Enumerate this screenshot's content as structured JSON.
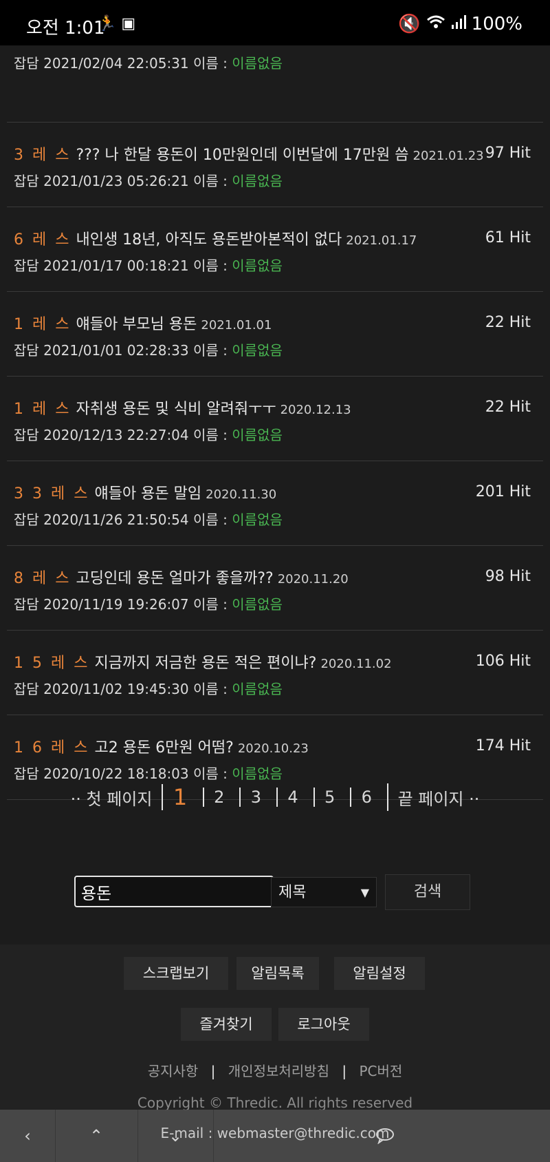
{
  "status_bar": {
    "time": "오전 1:01",
    "battery": "100%",
    "icons_left": [
      "person-icon",
      "document-icon"
    ],
    "icons_right": [
      "mute-icon",
      "wifi-icon",
      "signal-icon"
    ]
  },
  "partial_row": {
    "meta_category": "잡담",
    "meta_datetime": "2021/02/04 22:05:31",
    "meta_name_label": "이름 :",
    "meta_name": "이름없음"
  },
  "threads": [
    {
      "res": "3 레 스",
      "title": "??? 나 한달 용돈이 10만원인데 이번달에 17만원 씀",
      "date": "2021.01.23",
      "hits": "97 Hit",
      "category": "잡담",
      "datetime": "2021/01/23 05:26:21",
      "name_label": "이름 :",
      "name": "이름없음"
    },
    {
      "res": "6 레 스",
      "title": "내인생 18년, 아직도 용돈받아본적이 없다",
      "date": "2021.01.17",
      "hits": "61 Hit",
      "category": "잡담",
      "datetime": "2021/01/17 00:18:21",
      "name_label": "이름 :",
      "name": "이름없음"
    },
    {
      "res": "1 레 스",
      "title": "얘들아 부모님 용돈",
      "date": "2021.01.01",
      "hits": "22 Hit",
      "category": "잡담",
      "datetime": "2021/01/01 02:28:33",
      "name_label": "이름 :",
      "name": "이름없음"
    },
    {
      "res": "1 레 스",
      "title": "자취생 용돈 및 식비 알려줘ㅜㅜ",
      "date": "2020.12.13",
      "hits": "22 Hit",
      "category": "잡담",
      "datetime": "2020/12/13 22:27:04",
      "name_label": "이름 :",
      "name": "이름없음"
    },
    {
      "res": "3 3 레 스",
      "title": "얘들아 용돈 말임",
      "date": "2020.11.30",
      "hits": "201 Hit",
      "category": "잡담",
      "datetime": "2020/11/26 21:50:54",
      "name_label": "이름 :",
      "name": "이름없음"
    },
    {
      "res": "8 레 스",
      "title": "고딩인데 용돈 얼마가 좋을까??",
      "date": "2020.11.20",
      "hits": "98 Hit",
      "category": "잡담",
      "datetime": "2020/11/19 19:26:07",
      "name_label": "이름 :",
      "name": "이름없음"
    },
    {
      "res": "1 5 레 스",
      "title": "지금까지 저금한 용돈 적은 편이냐?",
      "date": "2020.11.02",
      "hits": "106 Hit",
      "category": "잡담",
      "datetime": "2020/11/02 19:45:30",
      "name_label": "이름 :",
      "name": "이름없음"
    },
    {
      "res": "1 6 레 스",
      "title": "고2 용돈 6만원 어떰?",
      "date": "2020.10.23",
      "hits": "174 Hit",
      "category": "잡담",
      "datetime": "2020/10/22 18:18:03",
      "name_label": "이름 :",
      "name": "이름없음"
    }
  ],
  "pagination": {
    "first_label": "·· 첫 페이지",
    "current": "1",
    "pages": [
      "2",
      "3",
      "4",
      "5",
      "6"
    ],
    "last_label": "끝 페이지 ··"
  },
  "search": {
    "value": "용돈",
    "select_value": "제목",
    "button_label": "검색"
  },
  "footer": {
    "buttons_row1": [
      "스크랩보기",
      "알림목록",
      "알림설정"
    ],
    "buttons_row2": [
      "즐겨찾기",
      "로그아웃"
    ],
    "links": [
      "공지사항",
      "개인정보처리방침",
      "PC버전"
    ],
    "copyright": "Copyright © Thredic. All rights reserved",
    "email": "E-mail : webmaster@thredic.com"
  },
  "navbar": {
    "icons": [
      "back-icon",
      "scroll-top-icon",
      "scroll-bottom-icon",
      "comment-icon"
    ]
  }
}
